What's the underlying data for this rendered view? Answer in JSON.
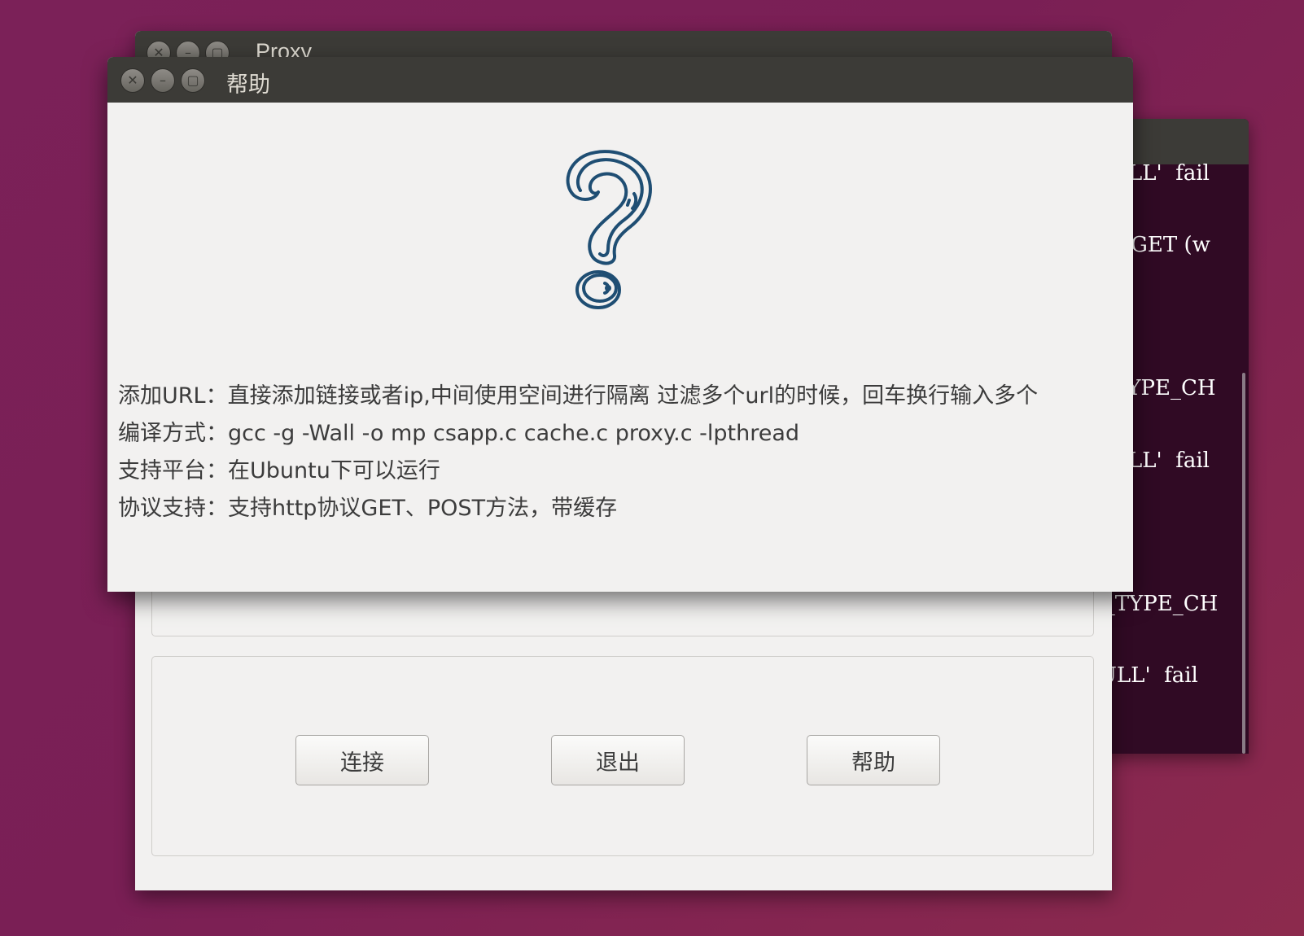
{
  "terminal": {
    "lines": [
      "LL'  fail",
      " DGET (w",
      "_TYPE_CH",
      "LL'  fail",
      "G_TYPE_CH",
      "ULL'  fail"
    ]
  },
  "proxy_window": {
    "title": "Proxy",
    "buttons": {
      "connect": "连接",
      "exit": "退出",
      "help": "帮助"
    }
  },
  "help_dialog": {
    "title": "帮助",
    "icon": "question-mark-icon",
    "lines": [
      "添加URL：直接添加链接或者ip,中间使用空间进行隔离 过滤多个url的时候，回车换行输入多个",
      "编译方式：gcc -g -Wall -o mp csapp.c cache.c proxy.c -lpthread",
      "支持平台：在Ubuntu下可以运行",
      "协议支持：支持http协议GET、POST方法，带缓存"
    ]
  },
  "colors": {
    "titlebar": "#3c3b37",
    "window_bg": "#f2f1f0",
    "terminal_bg": "#300a24",
    "desktop": "#7b2158",
    "icon_stroke": "#1f4e73"
  }
}
